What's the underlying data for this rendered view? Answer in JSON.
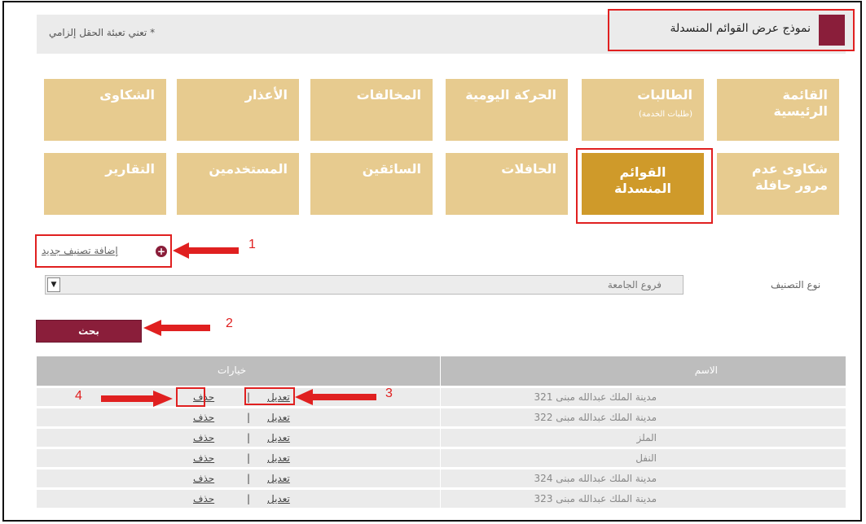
{
  "header": {
    "form_title": "نموذج عرض القوائم المنسدلة",
    "required_note": "* تعني تعبئة الحقل إلزامي"
  },
  "tiles_row1": [
    {
      "label": "القائمة الرئيسية",
      "sub": ""
    },
    {
      "label": "الطالبات",
      "sub": "(طلبات الخدمة)"
    },
    {
      "label": "الحركة اليومية",
      "sub": ""
    },
    {
      "label": "المخالفات",
      "sub": ""
    },
    {
      "label": "الأعذار",
      "sub": ""
    },
    {
      "label": "الشكاوى",
      "sub": ""
    }
  ],
  "tiles_row2": [
    {
      "label": "شكاوى عدم مرور حافلة",
      "sub": ""
    },
    {
      "label": "القوائم المنسدلة",
      "sub": "",
      "active": true
    },
    {
      "label": "الحافلات",
      "sub": ""
    },
    {
      "label": "السائقين",
      "sub": ""
    },
    {
      "label": "المستخدمين",
      "sub": ""
    },
    {
      "label": "التقارير",
      "sub": ""
    }
  ],
  "add_link": "إضافة تصنيف جديد",
  "filter": {
    "label": "نوع التصنيف",
    "selected": "فروع الجامعة"
  },
  "search_button": "بحث",
  "table": {
    "columns": [
      "الاسم",
      "خيارات"
    ],
    "edit_label": "تعديل",
    "delete_label": "حذف",
    "separator": "|",
    "rows": [
      "مدينة الملك عبدالله مبنى 321",
      "مدينة الملك عبدالله مبنى 322",
      "الملز",
      "النفل",
      "مدينة الملك عبدالله مبنى 324",
      "مدينة الملك عبدالله مبنى 323"
    ]
  },
  "annotations": [
    "1",
    "2",
    "3",
    "4"
  ],
  "colors": {
    "accent": "#8a1e3a",
    "tile": "#e7cb8f",
    "tile_active": "#cf9a2a",
    "annotation": "#e02020"
  }
}
